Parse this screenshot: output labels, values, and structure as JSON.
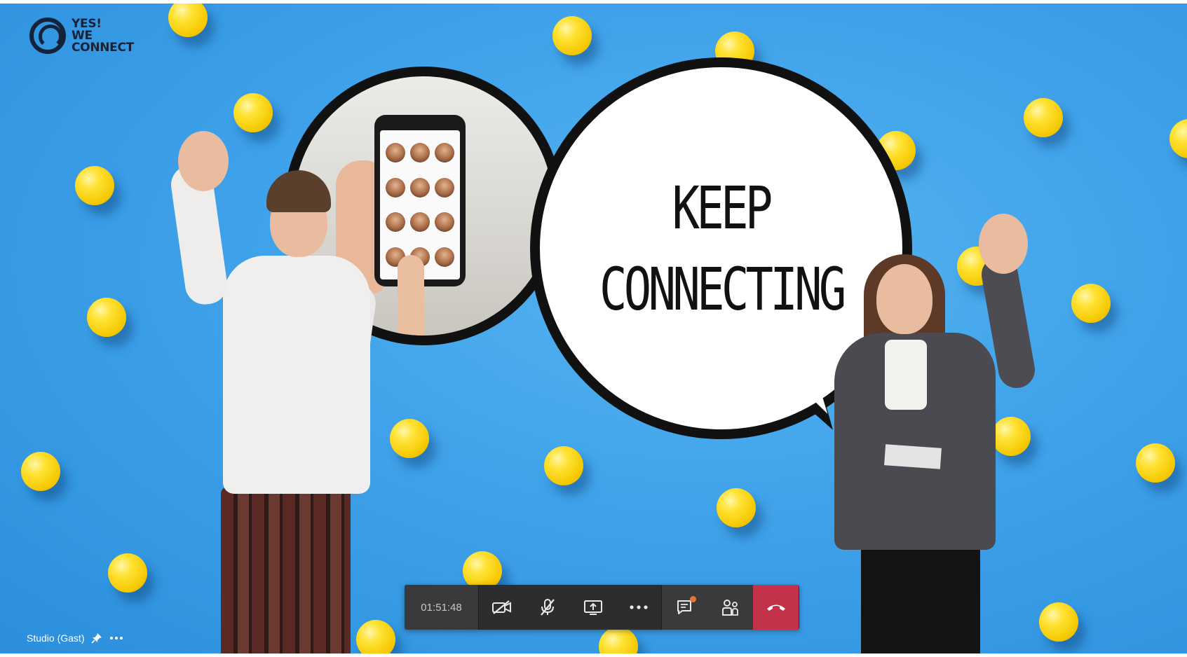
{
  "logo": {
    "line1": "YES!",
    "line2": "WE",
    "line3": "CONNECT"
  },
  "bubble": {
    "line1": "KEEP",
    "line2": "CONNECTING"
  },
  "participant": {
    "name": "Studio (Gast)",
    "icons": [
      "pin-icon",
      "more-icon"
    ]
  },
  "toolbar": {
    "timer": "01:51:48",
    "buttons": [
      {
        "id": "camera",
        "icon": "camera-off-icon"
      },
      {
        "id": "mic",
        "icon": "mic-off-icon"
      },
      {
        "id": "share",
        "icon": "share-screen-icon"
      },
      {
        "id": "more",
        "icon": "more-actions-icon"
      },
      {
        "id": "chat",
        "icon": "chat-icon",
        "badge": true
      },
      {
        "id": "participants",
        "icon": "participants-icon"
      },
      {
        "id": "hangup",
        "icon": "hang-up-icon"
      }
    ]
  },
  "colors": {
    "background": "#3fa2ea",
    "balls": "#f5c800",
    "toolbar": "#2d2d2f",
    "hangup": "#c4314b",
    "chat_badge": "#e8743b"
  }
}
